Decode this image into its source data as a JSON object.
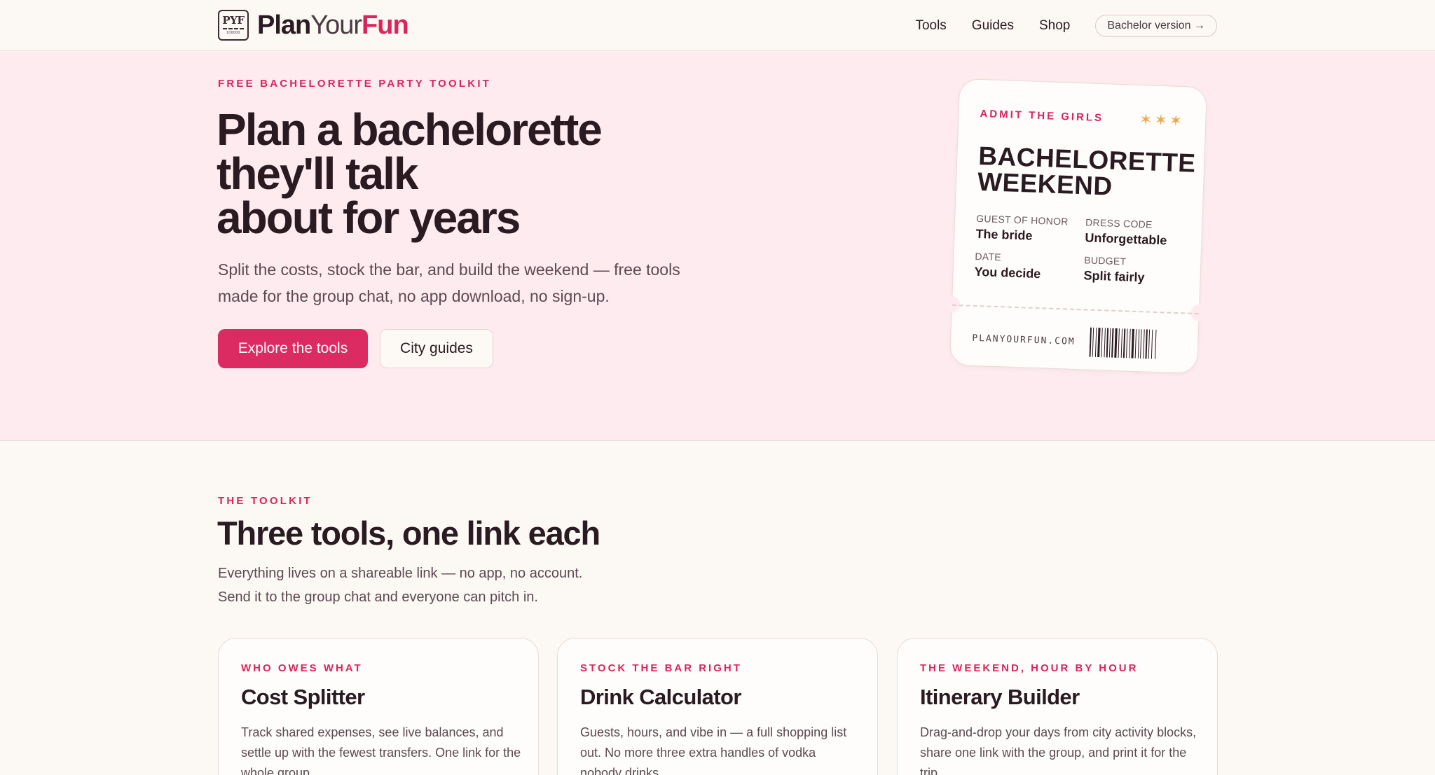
{
  "brand": {
    "monogram": "PYF",
    "monogram_sub": "100000",
    "name_part1": "Plan",
    "name_part2": "Your",
    "name_part3": "Fun"
  },
  "nav": {
    "links": [
      "Tools",
      "Guides",
      "Shop"
    ],
    "pill": "Bachelor version →"
  },
  "hero": {
    "eyebrow": "FREE BACHELORETTE PARTY TOOLKIT",
    "title_lines": [
      "Plan a bachelorette",
      "they'll talk",
      "about for years"
    ],
    "subtitle": "Split the costs, stock the bar, and build the weekend — free tools made for the group chat, no app download, no sign-up.",
    "primary_button": "Explore the tools",
    "secondary_button": "City guides"
  },
  "ticket": {
    "eyebrow": "ADMIT THE GIRLS",
    "stars": "✶✶✶",
    "title_lines": [
      "BACHELORETTE",
      "WEEKEND"
    ],
    "fields": [
      {
        "label": "GUEST OF HONOR",
        "value": "The bride"
      },
      {
        "label": "DRESS CODE",
        "value": "Unforgettable"
      },
      {
        "label": "DATE",
        "value": "You decide"
      },
      {
        "label": "BUDGET",
        "value": "Split fairly"
      }
    ],
    "url": "PLANYOURFUN.COM"
  },
  "toolkit": {
    "eyebrow": "THE TOOLKIT",
    "title": "Three tools, one link each",
    "subtitle_lines": [
      "Everything lives on a shareable link — no app, no account.",
      "Send it to the group chat and everyone can pitch in."
    ],
    "cards": [
      {
        "eyebrow": "WHO OWES WHAT",
        "title": "Cost Splitter",
        "desc": "Track shared expenses, see live balances, and settle up with the fewest transfers. One link for the whole group."
      },
      {
        "eyebrow": "STOCK THE BAR RIGHT",
        "title": "Drink Calculator",
        "desc": "Guests, hours, and vibe in — a full shopping list out. No more three extra handles of vodka nobody drinks."
      },
      {
        "eyebrow": "THE WEEKEND, HOUR BY HOUR",
        "title": "Itinerary Builder",
        "desc": "Drag-and-drop your days from city activity blocks, share one link with the group, and print it for the trip."
      }
    ]
  },
  "colors": {
    "accent": "#d9245e",
    "hero_bg": "#fdebef",
    "page_bg": "#fcf8f4",
    "ink": "#2a1a22",
    "star": "#e9a94a"
  }
}
